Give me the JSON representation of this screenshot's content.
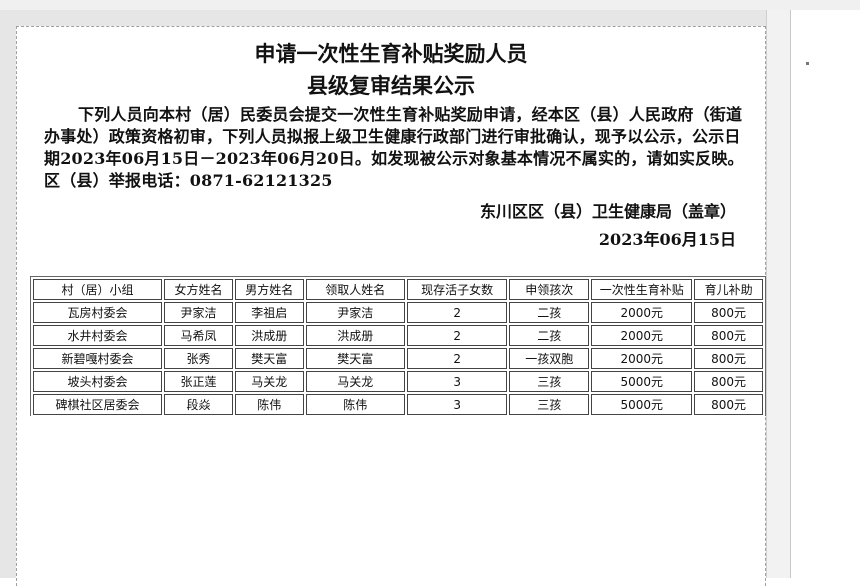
{
  "title_line1": "申请一次性生育补贴奖励人员",
  "title_line2": "县级复审结果公示",
  "notice": "下列人员向本村（居）民委员会提交一次性生育补贴奖励申请，经本区（县）人民政府（街道办事处）政策资格初审，下列人员拟报上级卫生健康行政部门进行审批确认，现予以公示，公示日期2023年06月15日－2023年06月20日。如发现被公示对象基本情况不属实的，请如实反映。区（县）举报电话：0871-62121325",
  "issuer": "东川区区（县）卫生健康局（盖章）",
  "date": "2023年06月15日",
  "table": {
    "headers": [
      "村（居）小组",
      "女方姓名",
      "男方姓名",
      "领取人姓名",
      "现存活子女数",
      "申领孩次",
      "一次性生育补贴",
      "育儿补助"
    ],
    "rows": [
      [
        "瓦房村委会",
        "尹家洁",
        "李祖启",
        "尹家洁",
        "2",
        "二孩",
        "2000元",
        "800元"
      ],
      [
        "水井村委会",
        "马希凤",
        "洪成册",
        "洪成册",
        "2",
        "二孩",
        "2000元",
        "800元"
      ],
      [
        "新碧嘎村委会",
        "张秀",
        "樊天富",
        "樊天富",
        "2",
        "一孩双胞",
        "2000元",
        "800元"
      ],
      [
        "坡头村委会",
        "张正莲",
        "马关龙",
        "马关龙",
        "3",
        "三孩",
        "5000元",
        "800元"
      ],
      [
        "碑棋社区居委会",
        "段焱",
        "陈伟",
        "陈伟",
        "3",
        "三孩",
        "5000元",
        "800元"
      ]
    ]
  }
}
